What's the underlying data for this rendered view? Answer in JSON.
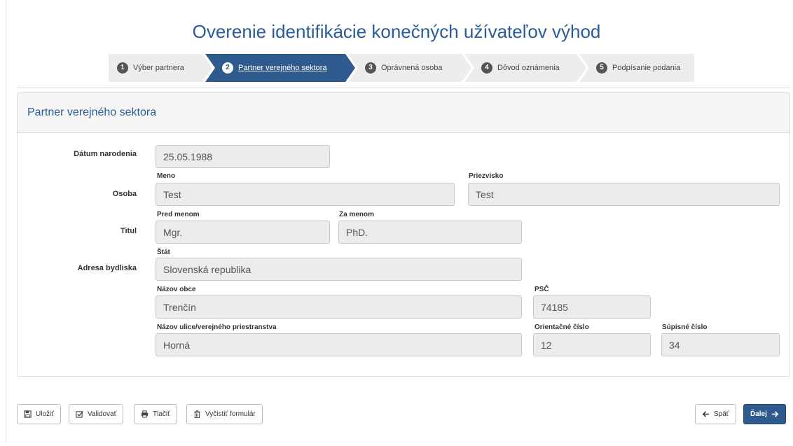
{
  "title": "Overenie identifikácie konečných užívateľov výhod",
  "wizard": {
    "steps": [
      {
        "num": "1",
        "label": "Výber partnera"
      },
      {
        "num": "2",
        "label": "Partner verejného sektora"
      },
      {
        "num": "3",
        "label": "Oprávnená osoba"
      },
      {
        "num": "4",
        "label": "Dôvod oznámenia"
      },
      {
        "num": "5",
        "label": "Podpísanie podania"
      }
    ],
    "active_step": 2
  },
  "panel": {
    "heading": "Partner verejného sektora",
    "rows": {
      "birth_date_label": "Dátum narodenia",
      "person_label": "Osoba",
      "title_label": "Titul",
      "address_label": "Adresa bydliska"
    },
    "fields": {
      "birth_date": {
        "value": "25.05.1988"
      },
      "first_name": {
        "label": "Meno",
        "value": "Test"
      },
      "last_name": {
        "label": "Priezvisko",
        "value": "Test"
      },
      "title_before": {
        "label": "Pred menom",
        "value": "Mgr."
      },
      "title_after": {
        "label": "Za menom",
        "value": "PhD."
      },
      "country": {
        "label": "Štát",
        "value": "Slovenská republika"
      },
      "municipality": {
        "label": "Názov obce",
        "value": "Trenčín"
      },
      "postal_code": {
        "label": "PSČ",
        "value": "74185"
      },
      "street": {
        "label": "Názov ulice/verejného priestranstva",
        "value": "Horná"
      },
      "orientation_number": {
        "label": "Orientačné číslo",
        "value": "12"
      },
      "registry_number": {
        "label": "Súpisné číslo",
        "value": "34"
      }
    }
  },
  "toolbar": {
    "save": "Uložiť",
    "validate": "Validovať",
    "print": "Tlačiť",
    "clear": "Vyčistiť formulár",
    "back": "Späť",
    "next": "Ďalej"
  },
  "colors": {
    "accent": "#2e5a8e",
    "title": "#2a5c9a",
    "field_bg": "#ececec"
  }
}
